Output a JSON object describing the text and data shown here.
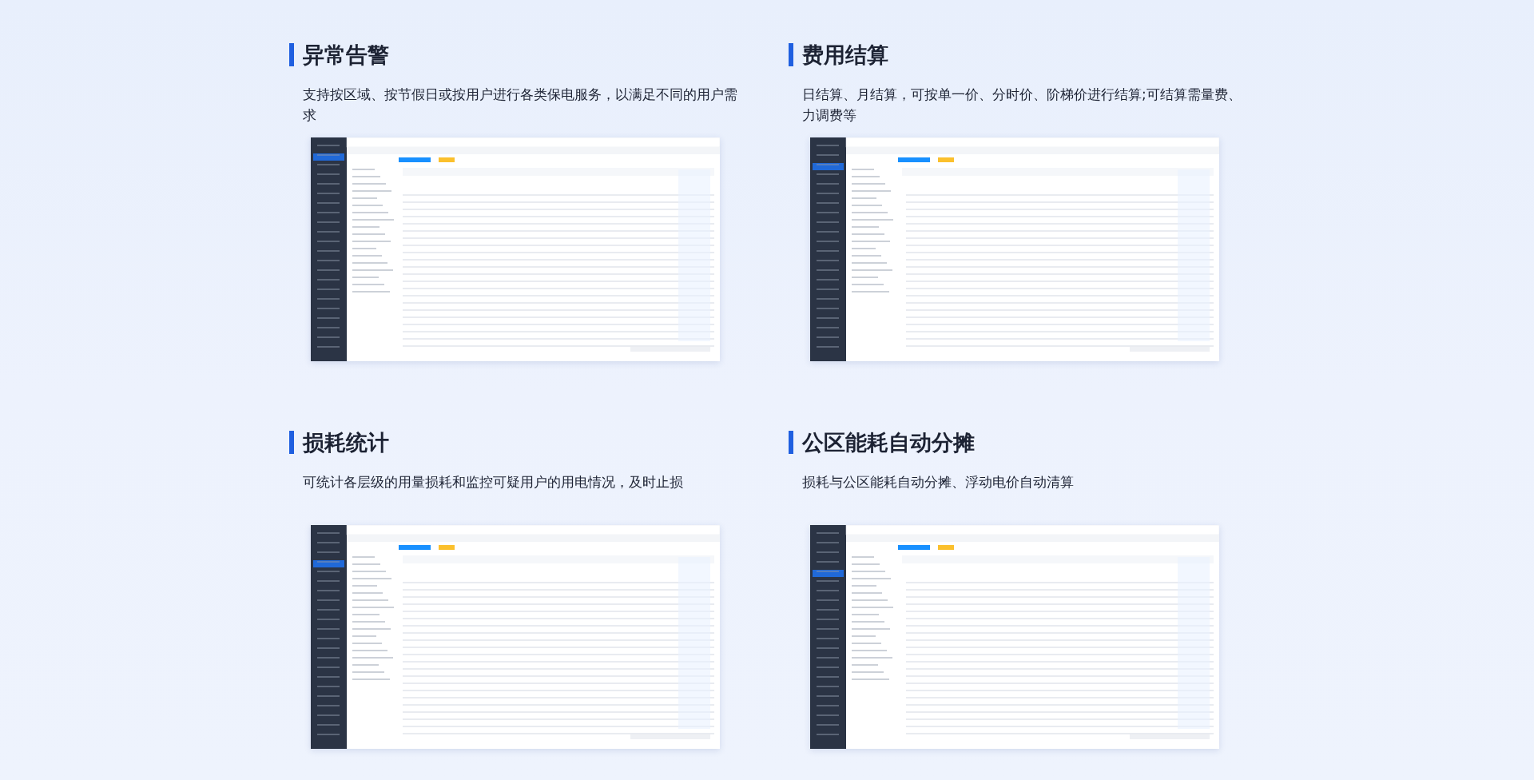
{
  "features": [
    {
      "title": "异常告警",
      "description": "支持按区域、按节假日或按用户进行各类保电服务，以满足不同的用户需求"
    },
    {
      "title": "费用结算",
      "description": "日结算、月结算，可按单一价、分时价、阶梯价进行结算;可结算需量费、力调费等"
    },
    {
      "title": "损耗统计",
      "description": "可统计各层级的用量损耗和监控可疑用户的用电情况，及时止损"
    },
    {
      "title": "公区能耗自动分摊",
      "description": "损耗与公区能耗自动分摊、浮动电价自动清算"
    }
  ]
}
